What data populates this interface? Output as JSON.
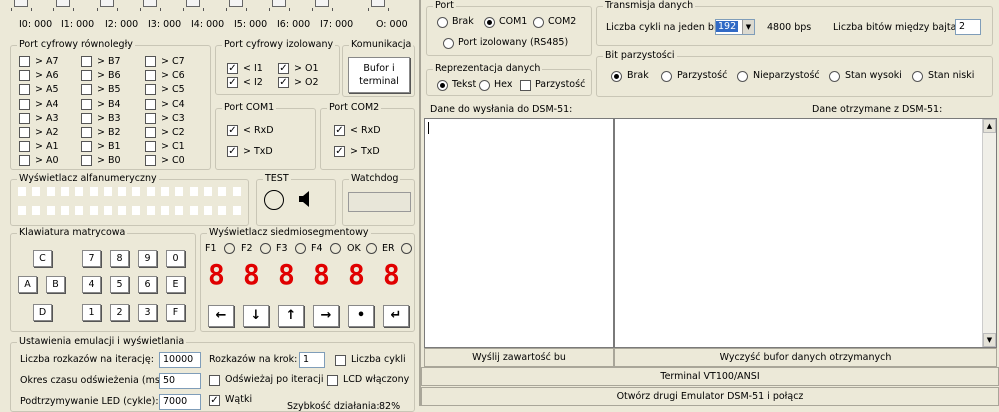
{
  "inputs_row": [
    "I0: 000",
    "I1: 000",
    "I2: 000",
    "I3: 000",
    "I4: 000",
    "I5: 000",
    "I6: 000",
    "I7: 000",
    "O: 000"
  ],
  "parallel": {
    "title": "Port cyfrowy równoległy",
    "colA": [
      "> A7",
      "> A6",
      "> A5",
      "> A4",
      "> A3",
      "> A2",
      "> A1",
      "> A0"
    ],
    "colB": [
      "> B7",
      "> B6",
      "> B5",
      "> B4",
      "> B3",
      "> B2",
      "> B1",
      "> B0"
    ],
    "colC": [
      "> C7",
      "> C6",
      "> C5",
      "> C4",
      "> C3",
      "> C2",
      "> C1",
      "> C0"
    ]
  },
  "isolated": {
    "title": "Port cyfrowy izolowany",
    "items": [
      "< I1",
      "> O1",
      "< I2",
      "> O2"
    ]
  },
  "komunikacja": {
    "title": "Komunikacja",
    "button": "Bufor i terminal"
  },
  "com1": {
    "title": "Port COM1",
    "items": [
      "< RxD",
      "> TxD"
    ]
  },
  "com2": {
    "title": "Port COM2",
    "items": [
      "< RxD",
      "> TxD"
    ]
  },
  "alnum": {
    "title": "Wyświetlacz alfanumeryczny"
  },
  "test": {
    "title": "TEST"
  },
  "watchdog": {
    "title": "Watchdog"
  },
  "keyboard": {
    "title": "Klawiatura matrycowa",
    "keys": [
      "C",
      "7",
      "8",
      "9",
      "0",
      "A",
      "B",
      "4",
      "5",
      "6",
      "E",
      "D",
      "1",
      "2",
      "3",
      "F"
    ]
  },
  "sevenseg": {
    "title": "Wyświetlacz siedmiosegmentowy",
    "leds": [
      "F1",
      "F2",
      "F3",
      "F4",
      "OK",
      "ER"
    ],
    "digits": [
      "8",
      "8",
      "8",
      "8",
      "8",
      "8"
    ],
    "arrows": [
      "←",
      "↓",
      "↑",
      "→",
      "•",
      "↵"
    ]
  },
  "emul": {
    "title": "Ustawienia emulacji i wyświetlania",
    "rozkazy_label": "Liczba rozkazów na iterację:",
    "rozkazy_value": "10000",
    "krok_label": "Rozkazów na krok:",
    "krok_value": "1",
    "cykle_label": "Liczba cykli",
    "okres_label": "Okres czasu odświeżenia (ms):",
    "okres_value": "50",
    "odswiezaj_label": "Odświeżaj po iteracji",
    "lcd_label": "LCD włączony",
    "led_label": "Podtrzymywanie LED (cykle):",
    "led_value": "7000",
    "watki_label": "Wątki",
    "speed_label": "Szybkość działania:",
    "speed_value": "82%"
  },
  "port": {
    "title": "Port",
    "options": [
      "Brak",
      "COM1",
      "COM2",
      "Port izolowany (RS485)"
    ],
    "selected": "COM1"
  },
  "repr": {
    "title": "Reprezentacja danych",
    "options": [
      "Tekst",
      "Hex"
    ],
    "selected": "Tekst",
    "parity_label": "Parzystość"
  },
  "transmisja": {
    "title": "Transmisja danych",
    "cycles_label": "Liczba cykli na jeden bit:",
    "cycles_value": "192",
    "bps": "4800 bps",
    "between_label": "Liczba bitów między bajtami:",
    "between_value": "2"
  },
  "parity": {
    "title": "Bit parzystości",
    "options": [
      "Brak",
      "Parzystość",
      "Nieparzystość",
      "Stan wysoki",
      "Stan niski"
    ],
    "selected": "Brak"
  },
  "buffers": {
    "send_label": "Dane do wysłania do DSM-51:",
    "recv_label": "Dane otrzymane z DSM-51:"
  },
  "buttons": {
    "send": "Wyślij zawartość bu",
    "clear": "Wyczyść bufor danych otrzymanych",
    "terminal": "Terminal VT100/ANSI",
    "emulator": "Otwórz drugi Emulator DSM-51 i połącz"
  }
}
